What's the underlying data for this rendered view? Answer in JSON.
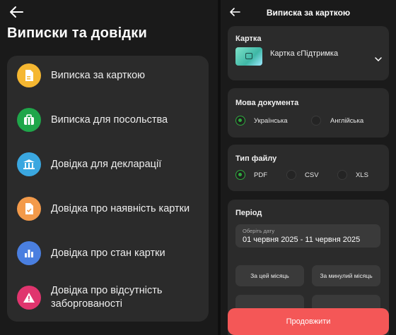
{
  "left": {
    "title": "Виписки та довідки",
    "items": [
      {
        "label": "Виписка за карткою",
        "icon": "document-icon",
        "color": "#f5b731"
      },
      {
        "label": "Виписка для посольства",
        "icon": "suitcase-icon",
        "color": "#1fa64a"
      },
      {
        "label": "Довідка для декларації",
        "icon": "bank-icon",
        "color": "#3aa7e0"
      },
      {
        "label": "Довідка про наявність картки",
        "icon": "card-document-icon",
        "color": "#f39a4a"
      },
      {
        "label": "Довідка про стан картки",
        "icon": "bar-chart-icon",
        "color": "#4a7fe0"
      },
      {
        "label": "Довідка про відсутність заборгованості",
        "icon": "warning-icon",
        "color": "#e0356e"
      }
    ]
  },
  "right": {
    "title": "Виписка за карткою",
    "card_section": {
      "title": "Картка",
      "card_name": "Картка єПідтримка"
    },
    "language_section": {
      "title": "Мова документа",
      "options": [
        "Українська",
        "Англійська"
      ],
      "selected": "Українська"
    },
    "filetype_section": {
      "title": "Тип файлу",
      "options": [
        "PDF",
        "CSV",
        "XLS"
      ],
      "selected": "PDF"
    },
    "period_section": {
      "title": "Період",
      "placeholder": "Оберіть дату",
      "value": "01 червня 2025 - 11 червня 2025",
      "chips": [
        "За цей місяць",
        "За минулий місяць"
      ]
    },
    "continue_label": "Продовжити"
  },
  "colors": {
    "accent_red": "#f45757",
    "radio_green": "#2faa3e"
  }
}
